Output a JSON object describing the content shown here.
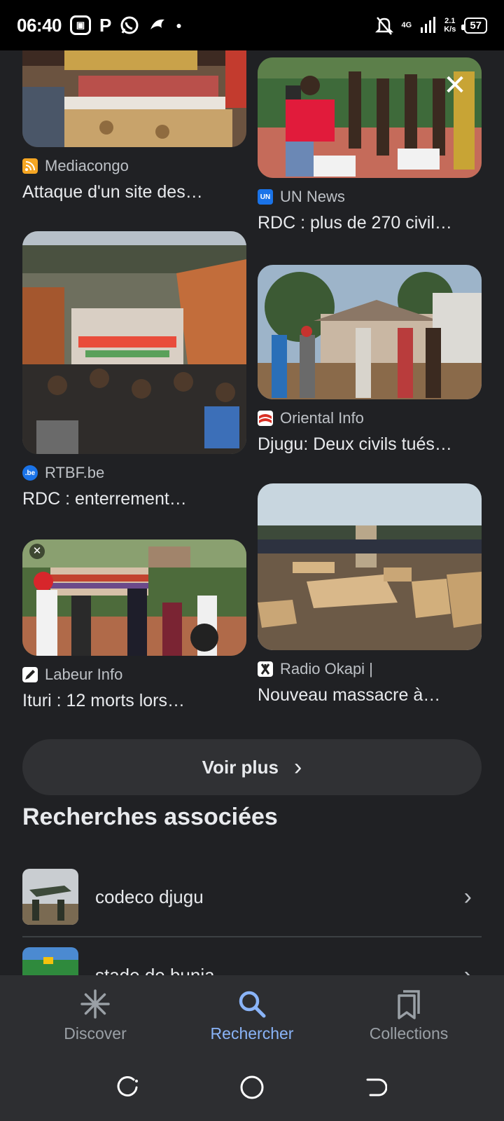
{
  "status_bar": {
    "time": "06:40",
    "icons_left": [
      "app-icon",
      "p-icon",
      "whatsapp-icon",
      "bird-icon",
      "dot-icon"
    ],
    "icons_right": [
      "bell-off-icon",
      "signal-icon"
    ],
    "network_type": "4G",
    "speed_value": "2.1",
    "speed_unit": "K/s",
    "battery": "57"
  },
  "results": [
    {
      "source": "Mediacongo",
      "title": "Attaque d'un site des…",
      "favicon_color": "#f5a623"
    },
    {
      "source": "UN News",
      "title": "RDC : plus de 270 civil…",
      "favicon_color": "#1a73e8"
    },
    {
      "source": "RTBF.be",
      "title": "RDC : enterrement…",
      "favicon_color": "#1a73e8"
    },
    {
      "source": "Oriental Info",
      "title": "Djugu: Deux civils tués…",
      "favicon_color": "#d93025"
    },
    {
      "source": "Labeur Info",
      "title": "Ituri : 12 morts lors…",
      "favicon_color": "#ffffff"
    },
    {
      "source": "Radio Okapi |",
      "title": "Nouveau massacre à…",
      "favicon_color": "#ffffff"
    }
  ],
  "favicon_text": {
    "un": "UN",
    "rtbf": ".be"
  },
  "close_glyph": "✕",
  "more_button": {
    "label": "Voir plus",
    "chevron": "›"
  },
  "related": {
    "title": "Recherches associées",
    "items": [
      {
        "label": "codeco djugu"
      },
      {
        "label": "stade de bunia"
      }
    ],
    "chevron": "›"
  },
  "bottom_nav": {
    "items": [
      {
        "label": "Discover",
        "icon": "asterisk-icon"
      },
      {
        "label": "Rechercher",
        "icon": "search-icon",
        "active": true
      },
      {
        "label": "Collections",
        "icon": "bookmarks-icon"
      }
    ]
  },
  "system_nav": [
    "recents-icon",
    "home-icon",
    "back-icon"
  ],
  "colors": {
    "background": "#202124",
    "accent": "#8ab4f8",
    "surface": "#303134"
  }
}
